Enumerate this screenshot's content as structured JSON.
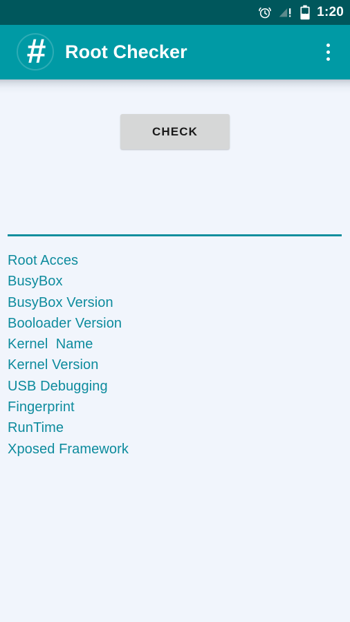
{
  "status_bar": {
    "background_color": "#00575c",
    "time": "1:20",
    "battery_level": "53",
    "icons": [
      {
        "name": "alarm-clock-icon",
        "label": "Alarm set"
      },
      {
        "name": "signal-no-service-icon",
        "label": "No service"
      },
      {
        "name": "battery-icon",
        "label": "Battery 53%"
      }
    ]
  },
  "app_bar": {
    "background_color": "#009aa5",
    "logo_glyph": "#",
    "logo_name": "hash-logo-icon",
    "title": "Root Checker",
    "overflow_menu_label": "More options"
  },
  "main": {
    "background_color": "#f1f5fc",
    "accent_color": "#0d8b9d",
    "check_button": {
      "label": "CHECK",
      "background_color": "#d6d7d7"
    },
    "divider_color": "#0e8e9d",
    "info_items": [
      {
        "label": "Root Acces"
      },
      {
        "label": "BusyBox"
      },
      {
        "label": "BusyBox Version"
      },
      {
        "label": "Booloader Version"
      },
      {
        "label": "Kernel  Name"
      },
      {
        "label": "Kernel Version"
      },
      {
        "label": "USB Debugging"
      },
      {
        "label": "Fingerprint"
      },
      {
        "label": "RunTime"
      },
      {
        "label": "Xposed Framework"
      }
    ]
  }
}
